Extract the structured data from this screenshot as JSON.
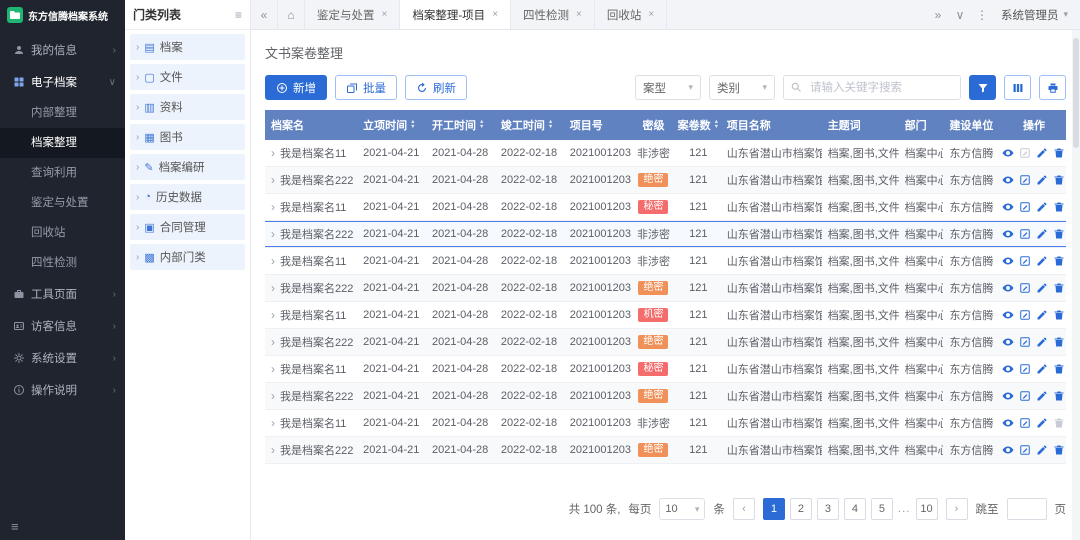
{
  "colors": {
    "accent": "#2b6bd5",
    "table_header_bg": "#6082c0",
    "sidebar_bg": "#20242e",
    "sidebar_active_bg": "#141821",
    "selected_row_border": "#4a7fe8",
    "badge_orange": "#f0915a",
    "badge_red": "#f56c6c",
    "logo_green": "#1fb573"
  },
  "icons": {
    "chevron-right": "›",
    "chevron-left": "‹",
    "chevron-down": "∨",
    "caret-down": "▾",
    "close": "×",
    "menu": "≡",
    "home": "⌂",
    "collapse": "«",
    "expand": "»",
    "more": "⋮",
    "archive-icon": "▤",
    "file-icon": "▢",
    "material-icon": "▥",
    "book-icon": "▦",
    "research-icon": "✎",
    "history-icon": "◔",
    "contract-icon": "▣",
    "internal-icon": "▩"
  },
  "app": {
    "logo_text": "东方信腾档案系统",
    "user": "系统管理员"
  },
  "sidebar": {
    "items": [
      {
        "label": "我的信息",
        "icon": "user-icon",
        "chevron": "right"
      },
      {
        "label": "电子档案",
        "icon": "apps-icon",
        "chevron": "down",
        "active": true,
        "expanded": true,
        "children": [
          {
            "label": "内部整理"
          },
          {
            "label": "档案整理",
            "active": true
          },
          {
            "label": "查询利用"
          },
          {
            "label": "鉴定与处置"
          },
          {
            "label": "回收站"
          },
          {
            "label": "四性检测"
          }
        ]
      },
      {
        "label": "工具页面",
        "icon": "briefcase-icon",
        "chevron": "right"
      },
      {
        "label": "访客信息",
        "icon": "visitor-icon",
        "chevron": "right"
      },
      {
        "label": "系统设置",
        "icon": "gear-icon",
        "chevron": "right"
      },
      {
        "label": "操作说明",
        "icon": "info-icon",
        "chevron": "right"
      }
    ]
  },
  "category_panel": {
    "title": "门类列表",
    "items": [
      {
        "label": "档案",
        "icon": "archive-icon"
      },
      {
        "label": "文件",
        "icon": "file-icon"
      },
      {
        "label": "资料",
        "icon": "material-icon"
      },
      {
        "label": "图书",
        "icon": "book-icon"
      },
      {
        "label": "档案编研",
        "icon": "research-icon"
      },
      {
        "label": "历史数据",
        "icon": "history-icon"
      },
      {
        "label": "合同管理",
        "icon": "contract-icon"
      },
      {
        "label": "内部门类",
        "icon": "internal-icon"
      }
    ]
  },
  "tabs": [
    {
      "label": "鉴定与处置",
      "active": false
    },
    {
      "label": "档案整理-项目",
      "active": true
    },
    {
      "label": "四性检测",
      "active": false
    },
    {
      "label": "回收站",
      "active": false
    }
  ],
  "content": {
    "title": "文书案卷整理",
    "toolbar": {
      "add": "新增",
      "batch": "批量",
      "refresh": "刷新",
      "case_type": "案型",
      "category": "类别",
      "search_placeholder": "请输入关键字搜索"
    },
    "table": {
      "columns": [
        {
          "label": "档案名",
          "sortable": false
        },
        {
          "label": "立项时间",
          "sortable": true
        },
        {
          "label": "开工时间",
          "sortable": true
        },
        {
          "label": "竣工时间",
          "sortable": true
        },
        {
          "label": "项目号",
          "sortable": false
        },
        {
          "label": "密级",
          "sortable": false
        },
        {
          "label": "案卷数",
          "sortable": true
        },
        {
          "label": "项目名称",
          "sortable": false
        },
        {
          "label": "主题词",
          "sortable": false
        },
        {
          "label": "部门",
          "sortable": false
        },
        {
          "label": "建设单位",
          "sortable": false
        },
        {
          "label": "操作",
          "sortable": false
        }
      ],
      "rows": [
        {
          "name": "我是档案名11",
          "start_date": "2021-04-21",
          "begin_date": "2021-04-28",
          "finish_date": "2022-02-18",
          "project_no": "2021001203",
          "secrecy": "非涉密",
          "badge": null,
          "volumes": "121",
          "project_name": "山东省潜山市档案馆",
          "keywords": "档案,图书,文件",
          "department": "档案中心",
          "builder": "东方信腾",
          "selected": false,
          "disabled_ops": [
            "edit-button"
          ]
        },
        {
          "name": "我是档案名222",
          "start_date": "2021-04-21",
          "begin_date": "2021-04-28",
          "finish_date": "2022-02-18",
          "project_no": "2021001203",
          "secrecy": "绝密",
          "badge": "badge_orange",
          "volumes": "121",
          "project_name": "山东省潜山市档案馆",
          "keywords": "档案,图书,文件",
          "department": "档案中心",
          "builder": "东方信腾",
          "selected": false,
          "disabled_ops": []
        },
        {
          "name": "我是档案名11",
          "start_date": "2021-04-21",
          "begin_date": "2021-04-28",
          "finish_date": "2022-02-18",
          "project_no": "2021001203",
          "secrecy": "秘密",
          "badge": "badge_red",
          "volumes": "121",
          "project_name": "山东省潜山市档案馆",
          "keywords": "档案,图书,文件",
          "department": "档案中心",
          "builder": "东方信腾",
          "selected": false,
          "disabled_ops": []
        },
        {
          "name": "我是档案名222",
          "start_date": "2021-04-21",
          "begin_date": "2021-04-28",
          "finish_date": "2022-02-18",
          "project_no": "2021001203",
          "secrecy": "非涉密",
          "badge": null,
          "volumes": "121",
          "project_name": "山东省潜山市档案馆",
          "keywords": "档案,图书,文件",
          "department": "档案中心",
          "builder": "东方信腾",
          "selected": true,
          "disabled_ops": []
        },
        {
          "name": "我是档案名11",
          "start_date": "2021-04-21",
          "begin_date": "2021-04-28",
          "finish_date": "2022-02-18",
          "project_no": "2021001203",
          "secrecy": "非涉密",
          "badge": null,
          "volumes": "121",
          "project_name": "山东省潜山市档案馆",
          "keywords": "档案,图书,文件",
          "department": "档案中心",
          "builder": "东方信腾",
          "selected": false,
          "disabled_ops": []
        },
        {
          "name": "我是档案名222",
          "start_date": "2021-04-21",
          "begin_date": "2021-04-28",
          "finish_date": "2022-02-18",
          "project_no": "2021001203",
          "secrecy": "绝密",
          "badge": "badge_orange",
          "volumes": "121",
          "project_name": "山东省潜山市档案馆",
          "keywords": "档案,图书,文件",
          "department": "档案中心",
          "builder": "东方信腾",
          "selected": false,
          "disabled_ops": []
        },
        {
          "name": "我是档案名11",
          "start_date": "2021-04-21",
          "begin_date": "2021-04-28",
          "finish_date": "2022-02-18",
          "project_no": "2021001203",
          "secrecy": "机密",
          "badge": "badge_red",
          "volumes": "121",
          "project_name": "山东省潜山市档案馆",
          "keywords": "档案,图书,文件",
          "department": "档案中心",
          "builder": "东方信腾",
          "selected": false,
          "disabled_ops": []
        },
        {
          "name": "我是档案名222",
          "start_date": "2021-04-21",
          "begin_date": "2021-04-28",
          "finish_date": "2022-02-18",
          "project_no": "2021001203",
          "secrecy": "绝密",
          "badge": "badge_orange",
          "volumes": "121",
          "project_name": "山东省潜山市档案馆",
          "keywords": "档案,图书,文件",
          "department": "档案中心",
          "builder": "东方信腾",
          "selected": false,
          "disabled_ops": []
        },
        {
          "name": "我是档案名11",
          "start_date": "2021-04-21",
          "begin_date": "2021-04-28",
          "finish_date": "2022-02-18",
          "project_no": "2021001203",
          "secrecy": "秘密",
          "badge": "badge_red",
          "volumes": "121",
          "project_name": "山东省潜山市档案馆",
          "keywords": "档案,图书,文件",
          "department": "档案中心",
          "builder": "东方信腾",
          "selected": false,
          "disabled_ops": []
        },
        {
          "name": "我是档案名222",
          "start_date": "2021-04-21",
          "begin_date": "2021-04-28",
          "finish_date": "2022-02-18",
          "project_no": "2021001203",
          "secrecy": "绝密",
          "badge": "badge_orange",
          "volumes": "121",
          "project_name": "山东省潜山市档案馆",
          "keywords": "档案,图书,文件",
          "department": "档案中心",
          "builder": "东方信腾",
          "selected": false,
          "disabled_ops": []
        },
        {
          "name": "我是档案名11",
          "start_date": "2021-04-21",
          "begin_date": "2021-04-28",
          "finish_date": "2022-02-18",
          "project_no": "2021001203",
          "secrecy": "非涉密",
          "badge": null,
          "volumes": "121",
          "project_name": "山东省潜山市档案馆",
          "keywords": "档案,图书,文件",
          "department": "档案中心",
          "builder": "东方信腾",
          "selected": false,
          "disabled_ops": [
            "delete-button"
          ]
        },
        {
          "name": "我是档案名222",
          "start_date": "2021-04-21",
          "begin_date": "2021-04-28",
          "finish_date": "2022-02-18",
          "project_no": "2021001203",
          "secrecy": "绝密",
          "badge": "badge_orange",
          "volumes": "121",
          "project_name": "山东省潜山市档案馆",
          "keywords": "档案,图书,文件",
          "department": "档案中心",
          "builder": "东方信腾",
          "selected": false,
          "disabled_ops": []
        }
      ]
    },
    "pagination": {
      "total": "共 100 条,",
      "per_page_label": "每页",
      "per_page_value": "10",
      "unit": "条",
      "pages": [
        "1",
        "2",
        "3",
        "4",
        "5",
        "...",
        "10"
      ],
      "active_page": "1",
      "jump_label": "跳至",
      "jump_unit": "页"
    }
  }
}
